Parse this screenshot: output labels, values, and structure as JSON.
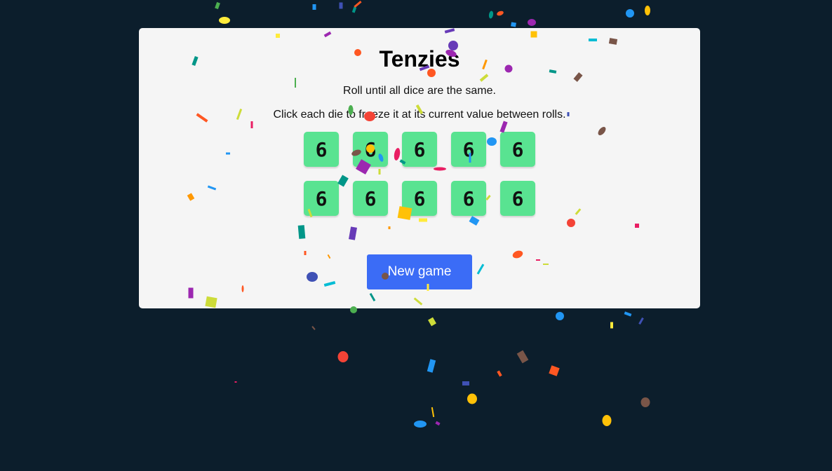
{
  "game": {
    "title": "Tenzies",
    "instructions_line1": "Roll until all dice are the same.",
    "instructions_line2": "Click each die to freeze it at its current value between rolls.",
    "dice": [
      "6",
      "6",
      "6",
      "6",
      "6",
      "6",
      "6",
      "6",
      "6",
      "6"
    ],
    "button_label": "New game"
  },
  "colors": {
    "background": "#0c1e2c",
    "card": "#f5f5f5",
    "die": "#59e391",
    "button": "#3b6cf6",
    "confetti": [
      "#f44336",
      "#e91e63",
      "#9c27b0",
      "#673ab7",
      "#3f51b5",
      "#2196f3",
      "#03a9f4",
      "#00bcd4",
      "#009688",
      "#4caf50",
      "#cddc39",
      "#ffeb3b",
      "#ffc107",
      "#ff9800",
      "#ff5722",
      "#795548"
    ]
  },
  "icons": {
    "confetti": "confetti-pieces"
  }
}
